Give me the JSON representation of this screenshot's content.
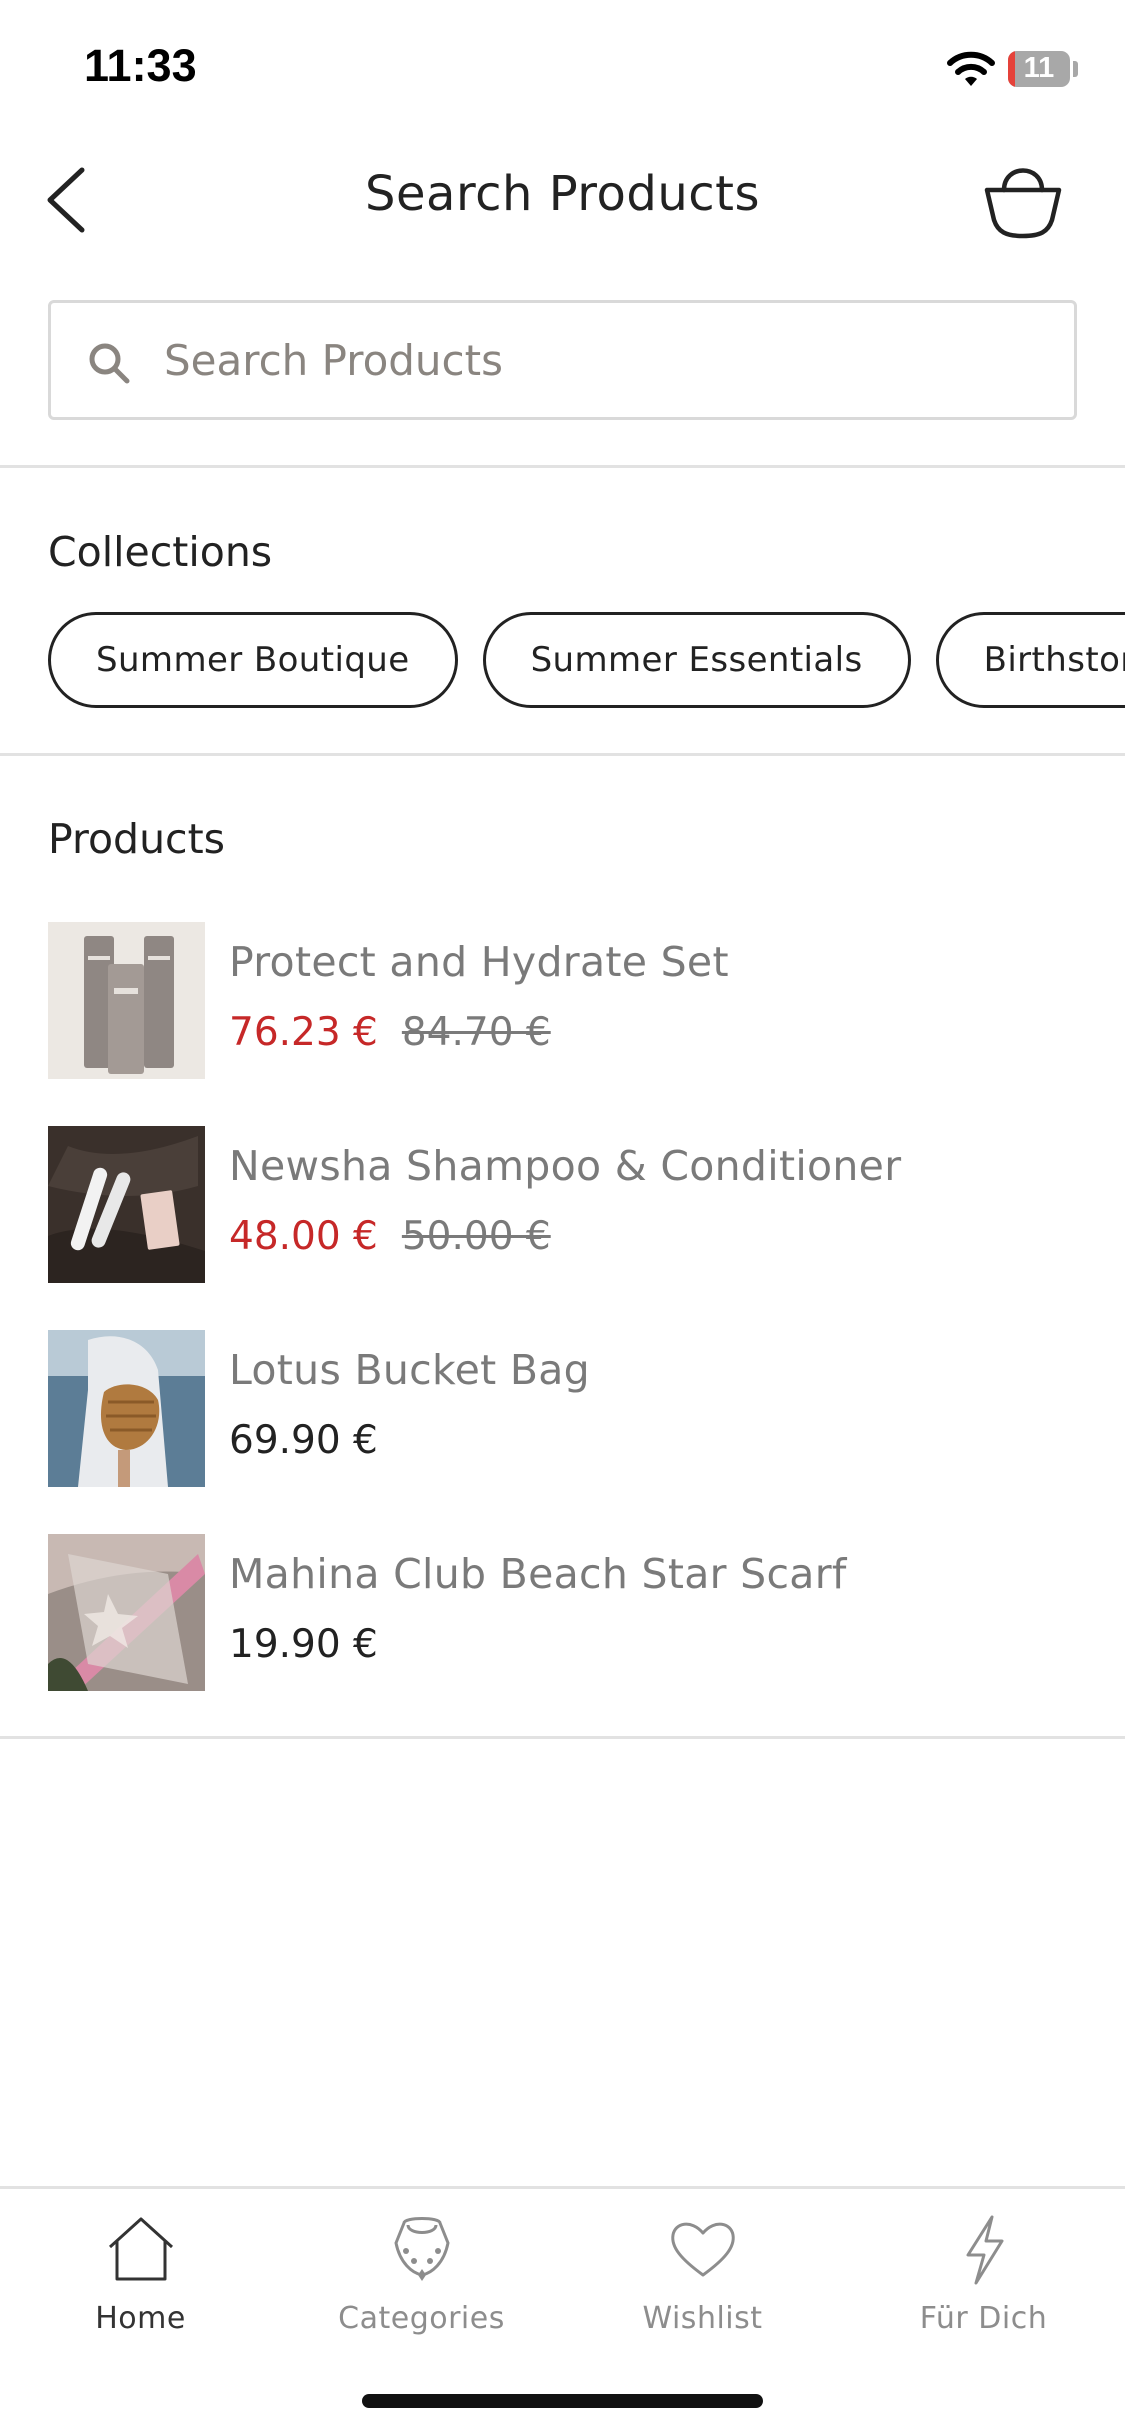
{
  "status_bar": {
    "time": "11:33",
    "battery_level": "11",
    "battery_fraction": 0.11
  },
  "header": {
    "title": "Search Products"
  },
  "search": {
    "placeholder": "Search Products",
    "value": ""
  },
  "collections": {
    "title": "Collections",
    "items": [
      "Summer Boutique",
      "Summer Essentials",
      "Birthstones"
    ]
  },
  "products": {
    "title": "Products",
    "items": [
      {
        "name": "Protect and Hydrate Set",
        "price": "76.23 €",
        "old_price": "84.70 €",
        "on_sale": true
      },
      {
        "name": "Newsha Shampoo & Conditioner",
        "price": "48.00 €",
        "old_price": "50.00 €",
        "on_sale": true
      },
      {
        "name": "Lotus Bucket Bag",
        "price": "69.90 €",
        "old_price": "",
        "on_sale": false
      },
      {
        "name": "Mahina Club Beach Star Scarf",
        "price": "19.90 €",
        "old_price": "",
        "on_sale": false
      }
    ]
  },
  "tabbar": {
    "tabs": [
      {
        "label": "Home",
        "icon": "home-icon",
        "active": true
      },
      {
        "label": "Categories",
        "icon": "necklace-icon",
        "active": false
      },
      {
        "label": "Wishlist",
        "icon": "heart-icon",
        "active": false
      },
      {
        "label": "Für Dich",
        "icon": "lightning-icon",
        "active": false
      }
    ]
  },
  "colors": {
    "sale": "#c62828",
    "muted": "#7a7a7a",
    "text": "#222222",
    "divider": "#e2e2e2"
  }
}
